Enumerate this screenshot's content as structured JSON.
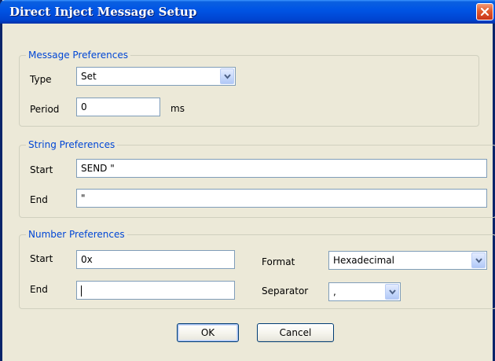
{
  "window": {
    "title": "Direct Inject Message Setup"
  },
  "message_prefs": {
    "legend": "Message Preferences",
    "type_label": "Type",
    "type_value": "Set",
    "period_label": "Period",
    "period_value": "0",
    "period_unit": "ms"
  },
  "string_prefs": {
    "legend": "String Preferences",
    "start_label": "Start",
    "start_value": "SEND \"",
    "end_label": "End",
    "end_value": "\""
  },
  "number_prefs": {
    "legend": "Number Preferences",
    "start_label": "Start",
    "start_value": "0x",
    "end_label": "End",
    "end_value": "",
    "format_label": "Format",
    "format_value": "Hexadecimal",
    "separator_label": "Separator",
    "separator_value": ","
  },
  "buttons": {
    "ok": "OK",
    "cancel": "Cancel"
  },
  "colors": {
    "titlebar": "#0055e5",
    "legend_text": "#0046d5",
    "dialog_bg": "#ece9d8",
    "close_button": "#e05a2d"
  },
  "icons": {
    "close": "close-icon",
    "dropdown": "chevron-down-icon"
  }
}
